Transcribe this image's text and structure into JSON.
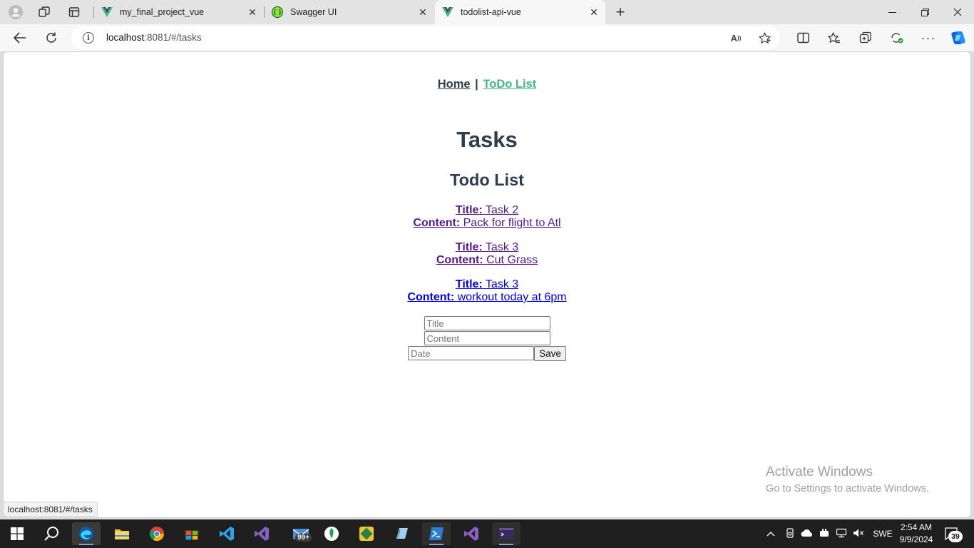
{
  "browser": {
    "tabs": [
      {
        "title": "my_final_project_vue",
        "icon": "vue-logo-icon"
      },
      {
        "title": "Swagger UI",
        "icon": "swagger-logo-icon"
      },
      {
        "title": "todolist-api-vue",
        "icon": "vue-logo-icon",
        "active": true
      }
    ],
    "address": {
      "host": "localhost",
      "rest": ":8081/#/tasks"
    },
    "status_url": "localhost:8081/#/tasks"
  },
  "page": {
    "nav": {
      "home": "Home",
      "separator": "|",
      "todo": "ToDo List"
    },
    "title": "Tasks",
    "subtitle": "Todo List",
    "tasks": [
      {
        "title_label": "Title:",
        "title": "Task 2",
        "content_label": "Content:",
        "content": "Pack for flight to Atl",
        "visited": true
      },
      {
        "title_label": "Title:",
        "title": "Task 3",
        "content_label": "Content:",
        "content": "Cut Grass",
        "visited": true
      },
      {
        "title_label": "Title:",
        "title": "Task 3",
        "content_label": "Content:",
        "content": "workout today at 6pm",
        "visited": false
      }
    ],
    "form": {
      "title_placeholder": "Title",
      "content_placeholder": "Content",
      "date_placeholder": "Date",
      "save_label": "Save"
    }
  },
  "watermark": {
    "line1": "Activate Windows",
    "line2": "Go to Settings to activate Windows."
  },
  "taskbar": {
    "clock_time": "2:54 AM",
    "clock_date": "9/9/2024",
    "language": "SWE",
    "mail_badge": "99+",
    "notification_count": "39"
  },
  "colors": {
    "vue_green": "#42b983",
    "heading": "#2c3e50",
    "visited_link": "#551a8b",
    "link": "#0000ee"
  }
}
